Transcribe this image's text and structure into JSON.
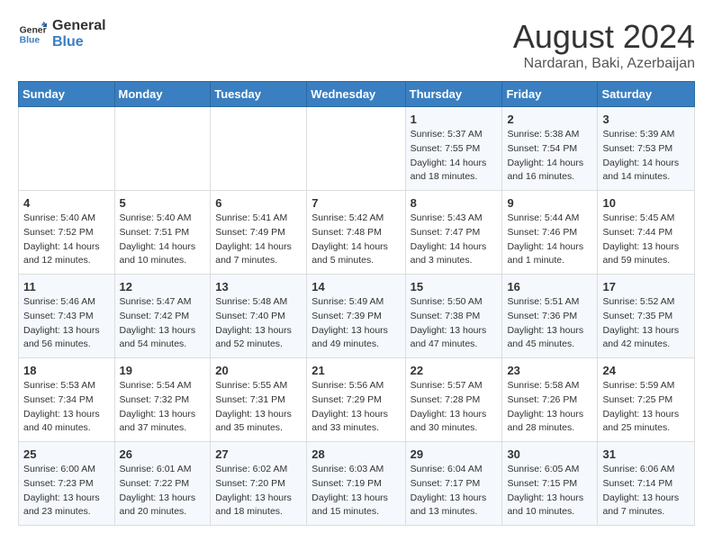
{
  "logo": {
    "line1": "General",
    "line2": "Blue"
  },
  "title": "August 2024",
  "subtitle": "Nardaran, Baki, Azerbaijan",
  "headers": [
    "Sunday",
    "Monday",
    "Tuesday",
    "Wednesday",
    "Thursday",
    "Friday",
    "Saturday"
  ],
  "weeks": [
    [
      {
        "num": "",
        "info": ""
      },
      {
        "num": "",
        "info": ""
      },
      {
        "num": "",
        "info": ""
      },
      {
        "num": "",
        "info": ""
      },
      {
        "num": "1",
        "info": "Sunrise: 5:37 AM\nSunset: 7:55 PM\nDaylight: 14 hours\nand 18 minutes."
      },
      {
        "num": "2",
        "info": "Sunrise: 5:38 AM\nSunset: 7:54 PM\nDaylight: 14 hours\nand 16 minutes."
      },
      {
        "num": "3",
        "info": "Sunrise: 5:39 AM\nSunset: 7:53 PM\nDaylight: 14 hours\nand 14 minutes."
      }
    ],
    [
      {
        "num": "4",
        "info": "Sunrise: 5:40 AM\nSunset: 7:52 PM\nDaylight: 14 hours\nand 12 minutes."
      },
      {
        "num": "5",
        "info": "Sunrise: 5:40 AM\nSunset: 7:51 PM\nDaylight: 14 hours\nand 10 minutes."
      },
      {
        "num": "6",
        "info": "Sunrise: 5:41 AM\nSunset: 7:49 PM\nDaylight: 14 hours\nand 7 minutes."
      },
      {
        "num": "7",
        "info": "Sunrise: 5:42 AM\nSunset: 7:48 PM\nDaylight: 14 hours\nand 5 minutes."
      },
      {
        "num": "8",
        "info": "Sunrise: 5:43 AM\nSunset: 7:47 PM\nDaylight: 14 hours\nand 3 minutes."
      },
      {
        "num": "9",
        "info": "Sunrise: 5:44 AM\nSunset: 7:46 PM\nDaylight: 14 hours\nand 1 minute."
      },
      {
        "num": "10",
        "info": "Sunrise: 5:45 AM\nSunset: 7:44 PM\nDaylight: 13 hours\nand 59 minutes."
      }
    ],
    [
      {
        "num": "11",
        "info": "Sunrise: 5:46 AM\nSunset: 7:43 PM\nDaylight: 13 hours\nand 56 minutes."
      },
      {
        "num": "12",
        "info": "Sunrise: 5:47 AM\nSunset: 7:42 PM\nDaylight: 13 hours\nand 54 minutes."
      },
      {
        "num": "13",
        "info": "Sunrise: 5:48 AM\nSunset: 7:40 PM\nDaylight: 13 hours\nand 52 minutes."
      },
      {
        "num": "14",
        "info": "Sunrise: 5:49 AM\nSunset: 7:39 PM\nDaylight: 13 hours\nand 49 minutes."
      },
      {
        "num": "15",
        "info": "Sunrise: 5:50 AM\nSunset: 7:38 PM\nDaylight: 13 hours\nand 47 minutes."
      },
      {
        "num": "16",
        "info": "Sunrise: 5:51 AM\nSunset: 7:36 PM\nDaylight: 13 hours\nand 45 minutes."
      },
      {
        "num": "17",
        "info": "Sunrise: 5:52 AM\nSunset: 7:35 PM\nDaylight: 13 hours\nand 42 minutes."
      }
    ],
    [
      {
        "num": "18",
        "info": "Sunrise: 5:53 AM\nSunset: 7:34 PM\nDaylight: 13 hours\nand 40 minutes."
      },
      {
        "num": "19",
        "info": "Sunrise: 5:54 AM\nSunset: 7:32 PM\nDaylight: 13 hours\nand 37 minutes."
      },
      {
        "num": "20",
        "info": "Sunrise: 5:55 AM\nSunset: 7:31 PM\nDaylight: 13 hours\nand 35 minutes."
      },
      {
        "num": "21",
        "info": "Sunrise: 5:56 AM\nSunset: 7:29 PM\nDaylight: 13 hours\nand 33 minutes."
      },
      {
        "num": "22",
        "info": "Sunrise: 5:57 AM\nSunset: 7:28 PM\nDaylight: 13 hours\nand 30 minutes."
      },
      {
        "num": "23",
        "info": "Sunrise: 5:58 AM\nSunset: 7:26 PM\nDaylight: 13 hours\nand 28 minutes."
      },
      {
        "num": "24",
        "info": "Sunrise: 5:59 AM\nSunset: 7:25 PM\nDaylight: 13 hours\nand 25 minutes."
      }
    ],
    [
      {
        "num": "25",
        "info": "Sunrise: 6:00 AM\nSunset: 7:23 PM\nDaylight: 13 hours\nand 23 minutes."
      },
      {
        "num": "26",
        "info": "Sunrise: 6:01 AM\nSunset: 7:22 PM\nDaylight: 13 hours\nand 20 minutes."
      },
      {
        "num": "27",
        "info": "Sunrise: 6:02 AM\nSunset: 7:20 PM\nDaylight: 13 hours\nand 18 minutes."
      },
      {
        "num": "28",
        "info": "Sunrise: 6:03 AM\nSunset: 7:19 PM\nDaylight: 13 hours\nand 15 minutes."
      },
      {
        "num": "29",
        "info": "Sunrise: 6:04 AM\nSunset: 7:17 PM\nDaylight: 13 hours\nand 13 minutes."
      },
      {
        "num": "30",
        "info": "Sunrise: 6:05 AM\nSunset: 7:15 PM\nDaylight: 13 hours\nand 10 minutes."
      },
      {
        "num": "31",
        "info": "Sunrise: 6:06 AM\nSunset: 7:14 PM\nDaylight: 13 hours\nand 7 minutes."
      }
    ]
  ]
}
